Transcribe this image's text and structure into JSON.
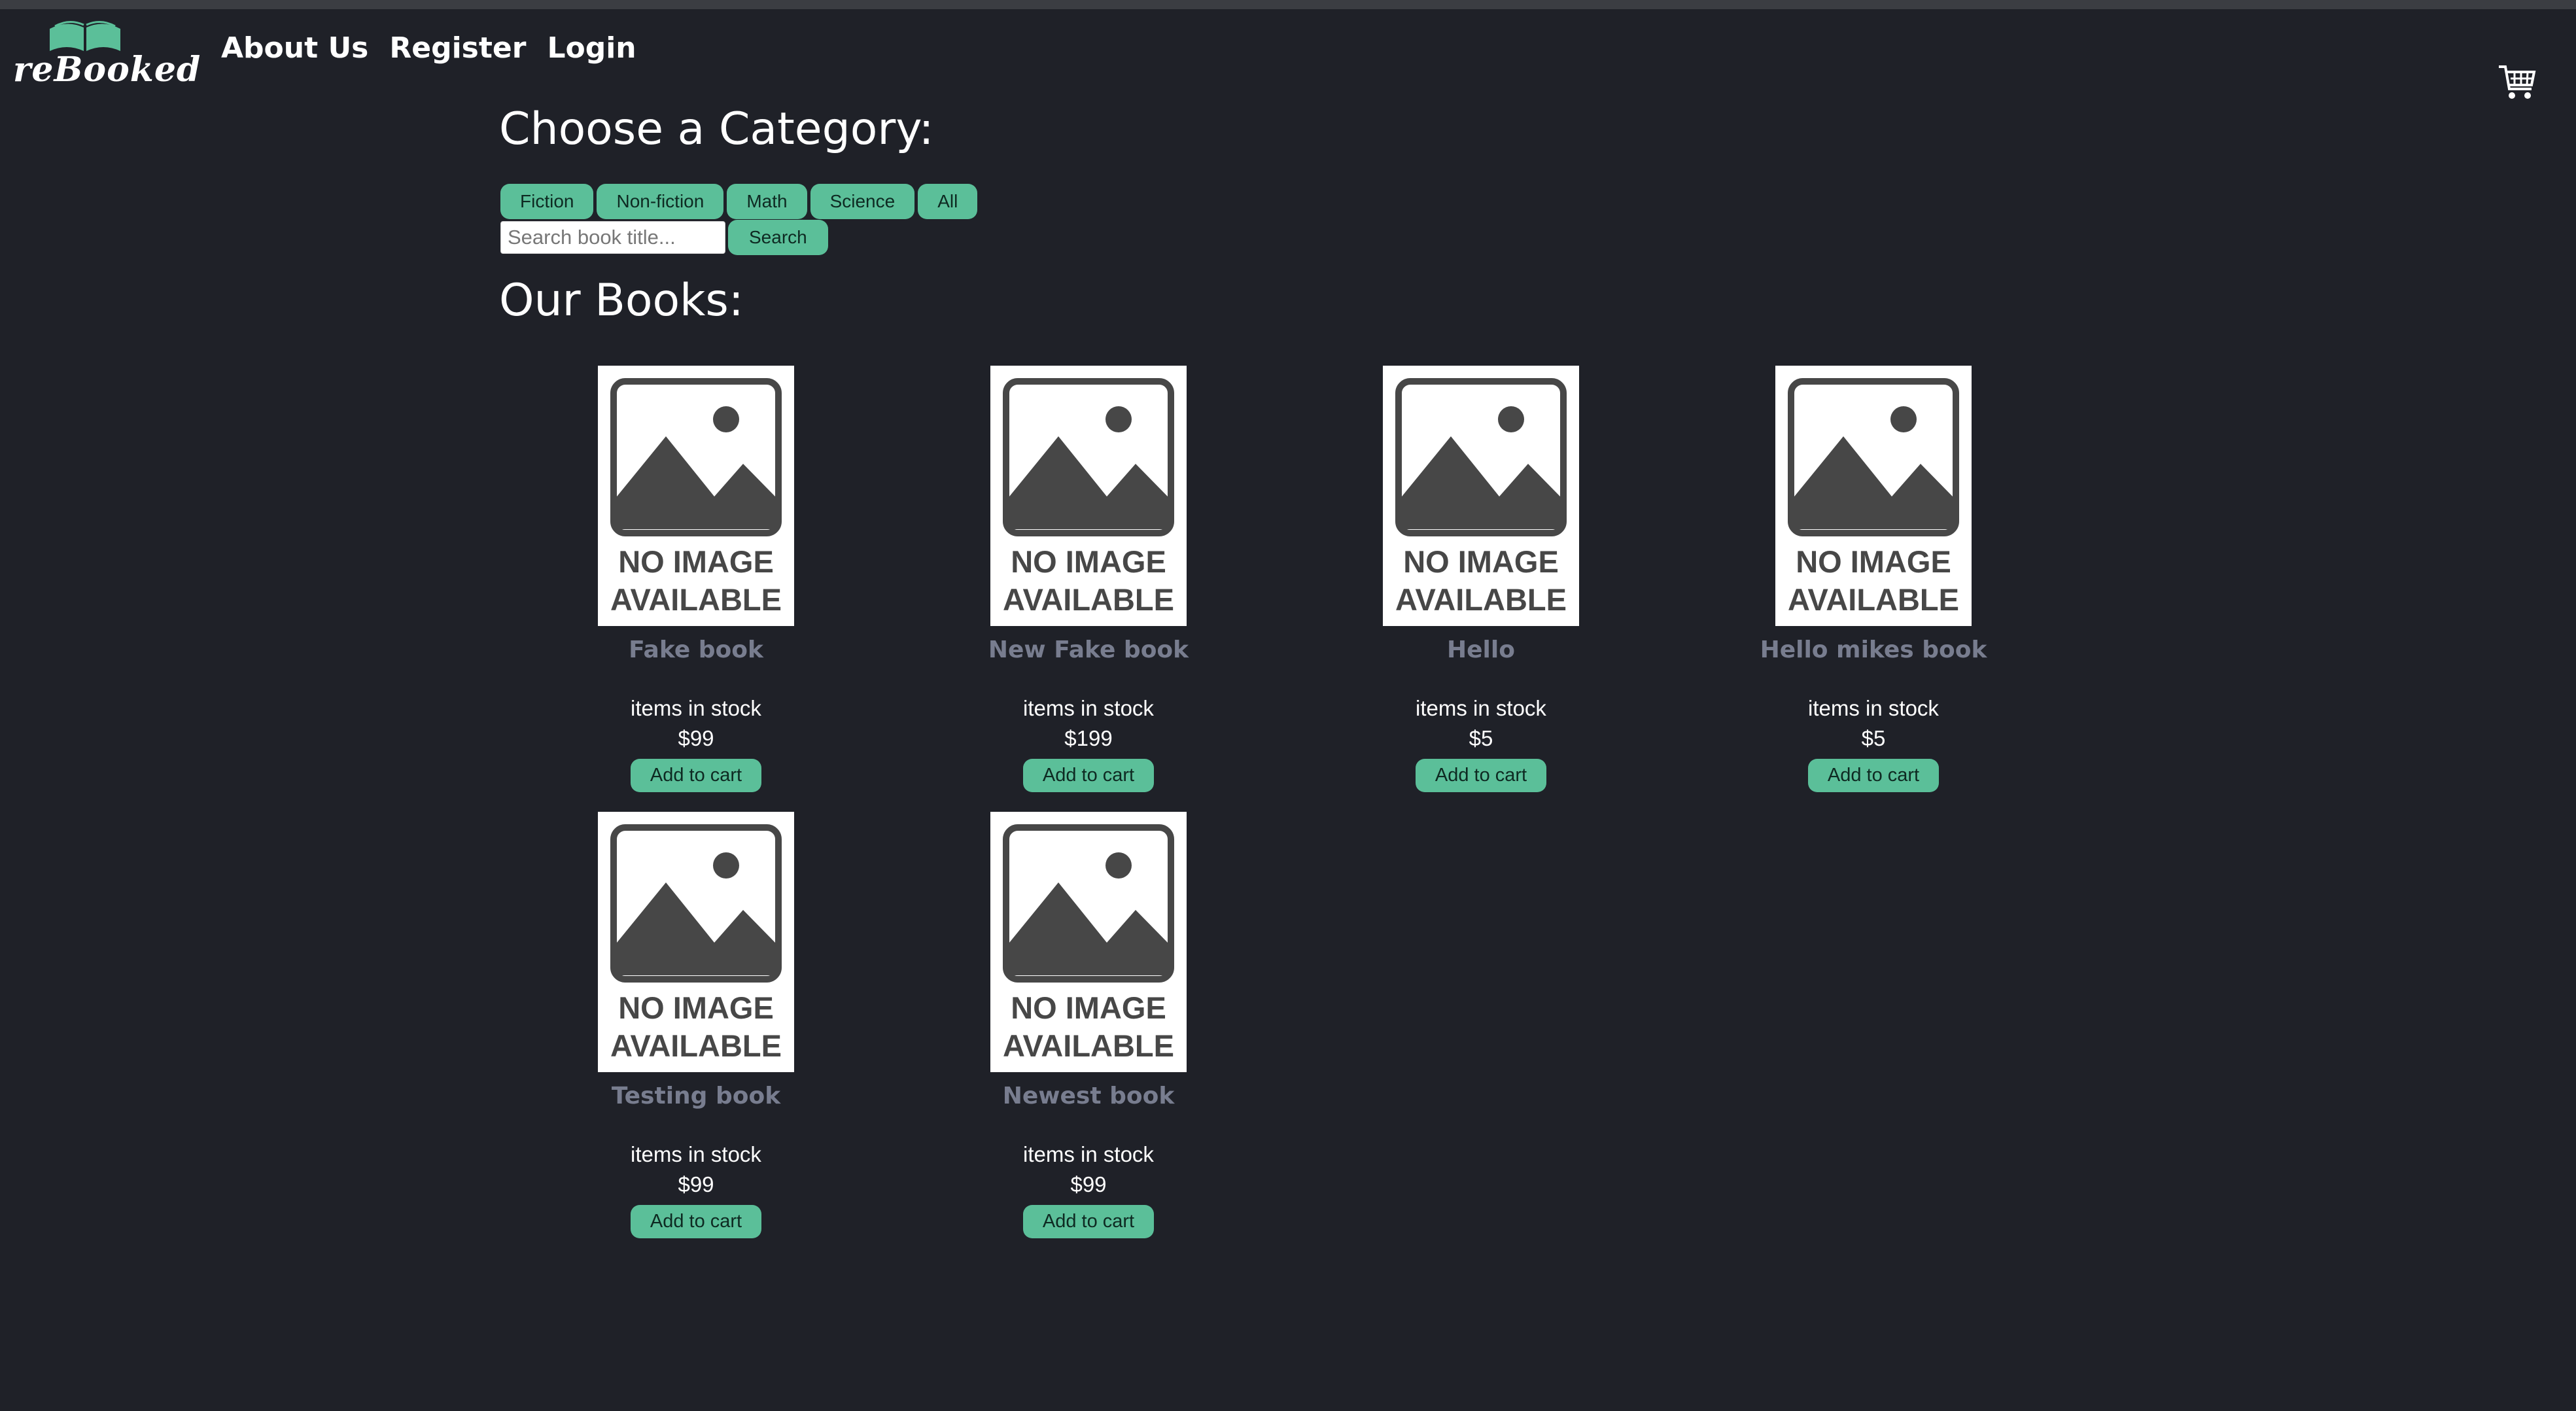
{
  "header": {
    "logo_text": "reBooked",
    "nav": [
      "About Us",
      "Register",
      "Login"
    ]
  },
  "category_heading": "Choose a Category:",
  "categories": [
    "Fiction",
    "Non-fiction",
    "Math",
    "Science",
    "All"
  ],
  "search": {
    "placeholder": "Search book title...",
    "button_label": "Search"
  },
  "books_heading": "Our Books:",
  "placeholder_image_text": [
    "NO IMAGE",
    "AVAILABLE"
  ],
  "books": [
    {
      "title": "Fake book",
      "stock_text": "items in stock",
      "price": "$99",
      "button": "Add to cart"
    },
    {
      "title": "New Fake book",
      "stock_text": "items in stock",
      "price": "$199",
      "button": "Add to cart"
    },
    {
      "title": "Hello",
      "stock_text": "items in stock",
      "price": "$5",
      "button": "Add to cart"
    },
    {
      "title": "Hello mikes book",
      "stock_text": "items in stock",
      "price": "$5",
      "button": "Add to cart"
    },
    {
      "title": "Testing book",
      "stock_text": "items in stock",
      "price": "$99",
      "button": "Add to cart"
    },
    {
      "title": "Newest book",
      "stock_text": "items in stock",
      "price": "$99",
      "button": "Add to cart"
    }
  ],
  "icons": {
    "logo": "open-book-icon",
    "cart": "shopping-cart-icon"
  },
  "colors": {
    "background": "#1f2128",
    "accent": "#5bbf99",
    "title_gray": "#787d8f"
  }
}
